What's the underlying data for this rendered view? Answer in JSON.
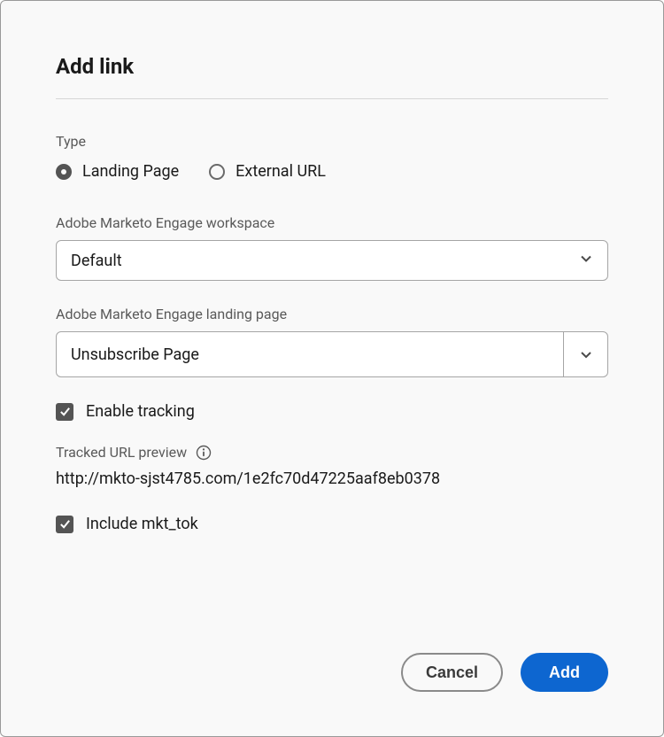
{
  "dialog": {
    "title": "Add link"
  },
  "type": {
    "label": "Type",
    "options": {
      "landing_page": "Landing Page",
      "external_url": "External URL"
    }
  },
  "workspace": {
    "label": "Adobe Marketo Engage workspace",
    "value": "Default"
  },
  "landing_page": {
    "label": "Adobe Marketo Engage landing page",
    "value": "Unsubscribe Page"
  },
  "tracking": {
    "enable_label": "Enable tracking",
    "preview_label": "Tracked URL preview",
    "preview_url": "http://mkto-sjst4785.com/1e2fc70d47225aaf8eb0378",
    "include_mkt_tok_label": "Include mkt_tok"
  },
  "buttons": {
    "cancel": "Cancel",
    "add": "Add"
  }
}
